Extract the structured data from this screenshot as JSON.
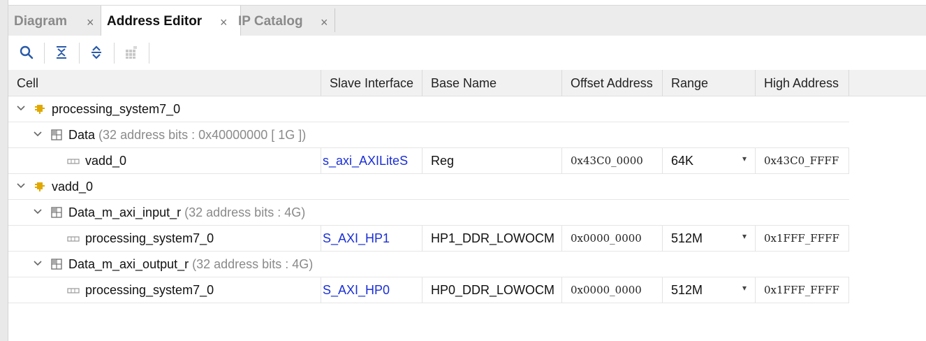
{
  "tabs": [
    {
      "label": "Diagram",
      "active": false
    },
    {
      "label": "Address Editor",
      "active": true
    },
    {
      "label": "IP Catalog",
      "active": false
    }
  ],
  "tab_close_glyph": "×",
  "toolbar": {
    "icons": [
      "search-icon",
      "collapse-all-icon",
      "expand-all-icon",
      "auto-assign-icon"
    ]
  },
  "columns": [
    "Cell",
    "Slave Interface",
    "Base Name",
    "Offset Address",
    "Range",
    "High Address"
  ],
  "rows": [
    {
      "level": 0,
      "type": "instance",
      "cell": "processing_system7_0",
      "suffix": ""
    },
    {
      "level": 1,
      "type": "space",
      "cell": "Data",
      "suffix": "(32 address bits : 0x40000000 [ 1G ])"
    },
    {
      "level": 2,
      "type": "segment",
      "cell": "vadd_0",
      "slave_interface": "s_axi_AXILiteS",
      "base_name": "Reg",
      "offset": "0x43C0_0000",
      "range": "64K",
      "high": "0x43C0_FFFF"
    },
    {
      "level": 0,
      "type": "instance",
      "cell": "vadd_0",
      "suffix": ""
    },
    {
      "level": 1,
      "type": "space",
      "cell": "Data_m_axi_input_r",
      "suffix": "(32 address bits : 4G)"
    },
    {
      "level": 2,
      "type": "segment",
      "cell": "processing_system7_0",
      "slave_interface": "S_AXI_HP1",
      "base_name": "HP1_DDR_LOWOCM",
      "offset": "0x0000_0000",
      "range": "512M",
      "high": "0x1FFF_FFFF"
    },
    {
      "level": 1,
      "type": "space",
      "cell": "Data_m_axi_output_r",
      "suffix": "(32 address bits : 4G)"
    },
    {
      "level": 2,
      "type": "segment",
      "cell": "processing_system7_0",
      "slave_interface": "S_AXI_HP0",
      "base_name": "HP0_DDR_LOWOCM",
      "offset": "0x0000_0000",
      "range": "512M",
      "high": "0x1FFF_FFFF"
    }
  ],
  "colors": {
    "link": "#1a2fd6",
    "instance_icon": "#e0a800",
    "muted": "#8a8a8a"
  }
}
